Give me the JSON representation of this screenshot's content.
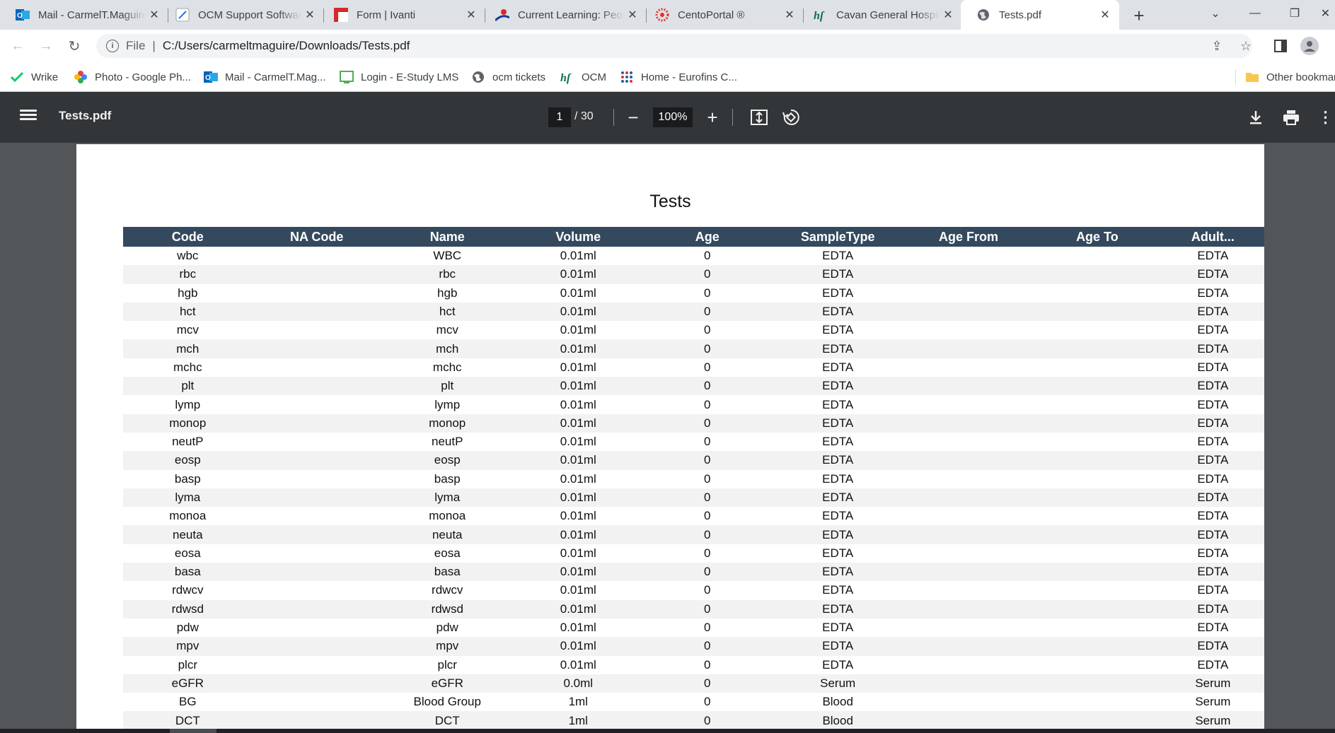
{
  "browser": {
    "tabs": [
      {
        "title": "Mail - CarmelT.Maguire",
        "icon": "outlook-icon",
        "active": false
      },
      {
        "title": "OCM Support Software",
        "icon": "ocm-support-icon",
        "active": false
      },
      {
        "title": "Form | Ivanti",
        "icon": "ivanti-icon",
        "active": false
      },
      {
        "title": "Current Learning: People",
        "icon": "learning-icon",
        "active": false
      },
      {
        "title": "CentoPortal ®",
        "icon": "cento-icon",
        "active": false
      },
      {
        "title": "Cavan General Hospital",
        "icon": "hse-icon",
        "active": false
      },
      {
        "title": "Tests.pdf",
        "icon": "globe-icon",
        "active": true
      }
    ],
    "address": {
      "scheme": "File",
      "url": "C:/Users/carmeltmaguire/Downloads/Tests.pdf"
    },
    "bookmarks": [
      {
        "label": "Wrike",
        "icon": "wrike-icon"
      },
      {
        "label": "Photo - Google Ph...",
        "icon": "google-photos-icon"
      },
      {
        "label": "Mail - CarmelT.Mag...",
        "icon": "outlook-icon"
      },
      {
        "label": "Login - E-Study LMS",
        "icon": "estudy-icon"
      },
      {
        "label": "ocm tickets",
        "icon": "globe-icon"
      },
      {
        "label": "OCM",
        "icon": "hse-icon"
      },
      {
        "label": "Home - Eurofins C...",
        "icon": "eurofins-icon"
      },
      {
        "label": "Other bookmarks",
        "icon": "folder-icon"
      }
    ]
  },
  "pdf": {
    "filename": "Tests.pdf",
    "current_page": "1",
    "total_pages": "/ 30",
    "zoom": "100%"
  },
  "document": {
    "title": "Tests",
    "columns": [
      "Code",
      "NA Code",
      "Name",
      "Volume",
      "Age",
      "SampleType",
      "Age From",
      "Age To",
      "Adult..."
    ],
    "rows": [
      [
        "wbc",
        "",
        "WBC",
        "0.01ml",
        "0",
        "EDTA",
        "",
        "",
        "EDTA"
      ],
      [
        "rbc",
        "",
        "rbc",
        "0.01ml",
        "0",
        "EDTA",
        "",
        "",
        "EDTA"
      ],
      [
        "hgb",
        "",
        "hgb",
        "0.01ml",
        "0",
        "EDTA",
        "",
        "",
        "EDTA"
      ],
      [
        "hct",
        "",
        "hct",
        "0.01ml",
        "0",
        "EDTA",
        "",
        "",
        "EDTA"
      ],
      [
        "mcv",
        "",
        "mcv",
        "0.01ml",
        "0",
        "EDTA",
        "",
        "",
        "EDTA"
      ],
      [
        "mch",
        "",
        "mch",
        "0.01ml",
        "0",
        "EDTA",
        "",
        "",
        "EDTA"
      ],
      [
        "mchc",
        "",
        "mchc",
        "0.01ml",
        "0",
        "EDTA",
        "",
        "",
        "EDTA"
      ],
      [
        "plt",
        "",
        "plt",
        "0.01ml",
        "0",
        "EDTA",
        "",
        "",
        "EDTA"
      ],
      [
        "lymp",
        "",
        "lymp",
        "0.01ml",
        "0",
        "EDTA",
        "",
        "",
        "EDTA"
      ],
      [
        "monop",
        "",
        "monop",
        "0.01ml",
        "0",
        "EDTA",
        "",
        "",
        "EDTA"
      ],
      [
        "neutP",
        "",
        "neutP",
        "0.01ml",
        "0",
        "EDTA",
        "",
        "",
        "EDTA"
      ],
      [
        "eosp",
        "",
        "eosp",
        "0.01ml",
        "0",
        "EDTA",
        "",
        "",
        "EDTA"
      ],
      [
        "basp",
        "",
        "basp",
        "0.01ml",
        "0",
        "EDTA",
        "",
        "",
        "EDTA"
      ],
      [
        "lyma",
        "",
        "lyma",
        "0.01ml",
        "0",
        "EDTA",
        "",
        "",
        "EDTA"
      ],
      [
        "monoa",
        "",
        "monoa",
        "0.01ml",
        "0",
        "EDTA",
        "",
        "",
        "EDTA"
      ],
      [
        "neuta",
        "",
        "neuta",
        "0.01ml",
        "0",
        "EDTA",
        "",
        "",
        "EDTA"
      ],
      [
        "eosa",
        "",
        "eosa",
        "0.01ml",
        "0",
        "EDTA",
        "",
        "",
        "EDTA"
      ],
      [
        "basa",
        "",
        "basa",
        "0.01ml",
        "0",
        "EDTA",
        "",
        "",
        "EDTA"
      ],
      [
        "rdwcv",
        "",
        "rdwcv",
        "0.01ml",
        "0",
        "EDTA",
        "",
        "",
        "EDTA"
      ],
      [
        "rdwsd",
        "",
        "rdwsd",
        "0.01ml",
        "0",
        "EDTA",
        "",
        "",
        "EDTA"
      ],
      [
        "pdw",
        "",
        "pdw",
        "0.01ml",
        "0",
        "EDTA",
        "",
        "",
        "EDTA"
      ],
      [
        "mpv",
        "",
        "mpv",
        "0.01ml",
        "0",
        "EDTA",
        "",
        "",
        "EDTA"
      ],
      [
        "plcr",
        "",
        "plcr",
        "0.01ml",
        "0",
        "EDTA",
        "",
        "",
        "EDTA"
      ],
      [
        "eGFR",
        "",
        "eGFR",
        "0.0ml",
        "0",
        "Serum",
        "",
        "",
        "Serum"
      ],
      [
        "BG",
        "",
        "Blood Group",
        "1ml",
        "0",
        "Blood",
        "",
        "",
        "Serum"
      ],
      [
        "DCT",
        "",
        "DCT",
        "1ml",
        "0",
        "Blood",
        "",
        "",
        "Serum"
      ]
    ]
  },
  "colors": {
    "tabstrip": "#dee1e6",
    "pdf_toolbar": "#323639",
    "viewer_bg": "#525659",
    "table_header": "#34495e",
    "row_stripe": "#f2f2f2"
  }
}
